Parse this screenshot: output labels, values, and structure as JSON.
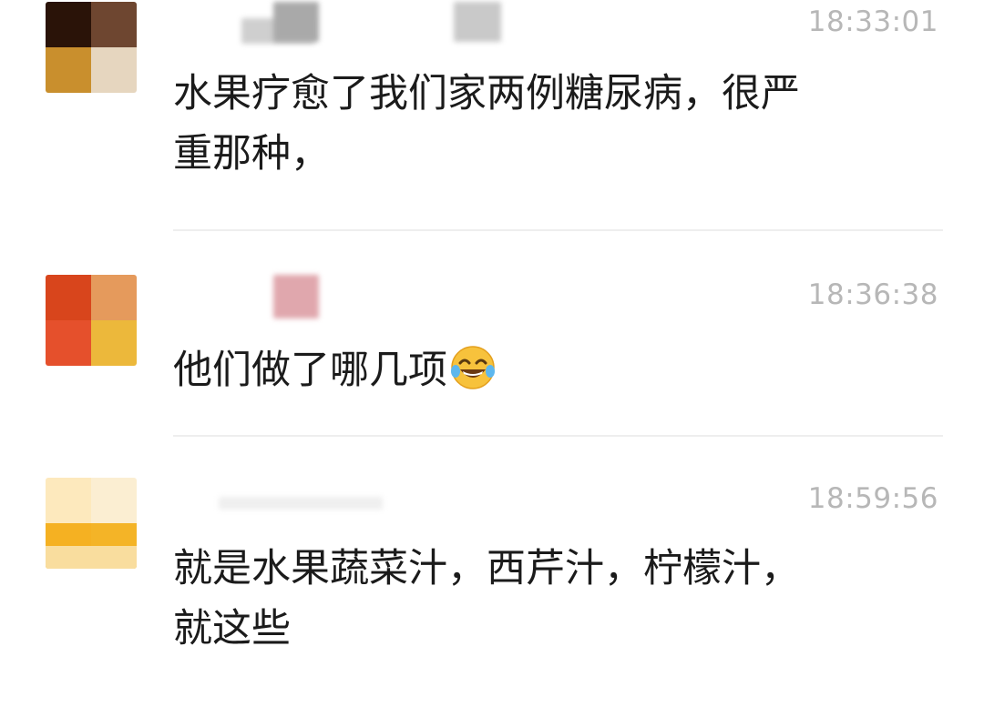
{
  "messages": [
    {
      "time": "18:33:01",
      "text_lines": [
        "水果疗愈了我们家两例糖尿病，很严",
        "重那种，"
      ]
    },
    {
      "time": "18:36:38",
      "text_lines": [
        "他们做了哪几项"
      ],
      "emoji": "face-with-tears-of-joy-icon"
    },
    {
      "time": "18:59:56",
      "text_lines": [
        "就是水果蔬菜汁，西芹汁，柠檬汁，",
        "就这些"
      ]
    }
  ],
  "colors": {
    "background": "#ffffff",
    "text": "#1b1b1b",
    "timestamp": "#b7b7b7",
    "divider": "#eeeeee"
  }
}
